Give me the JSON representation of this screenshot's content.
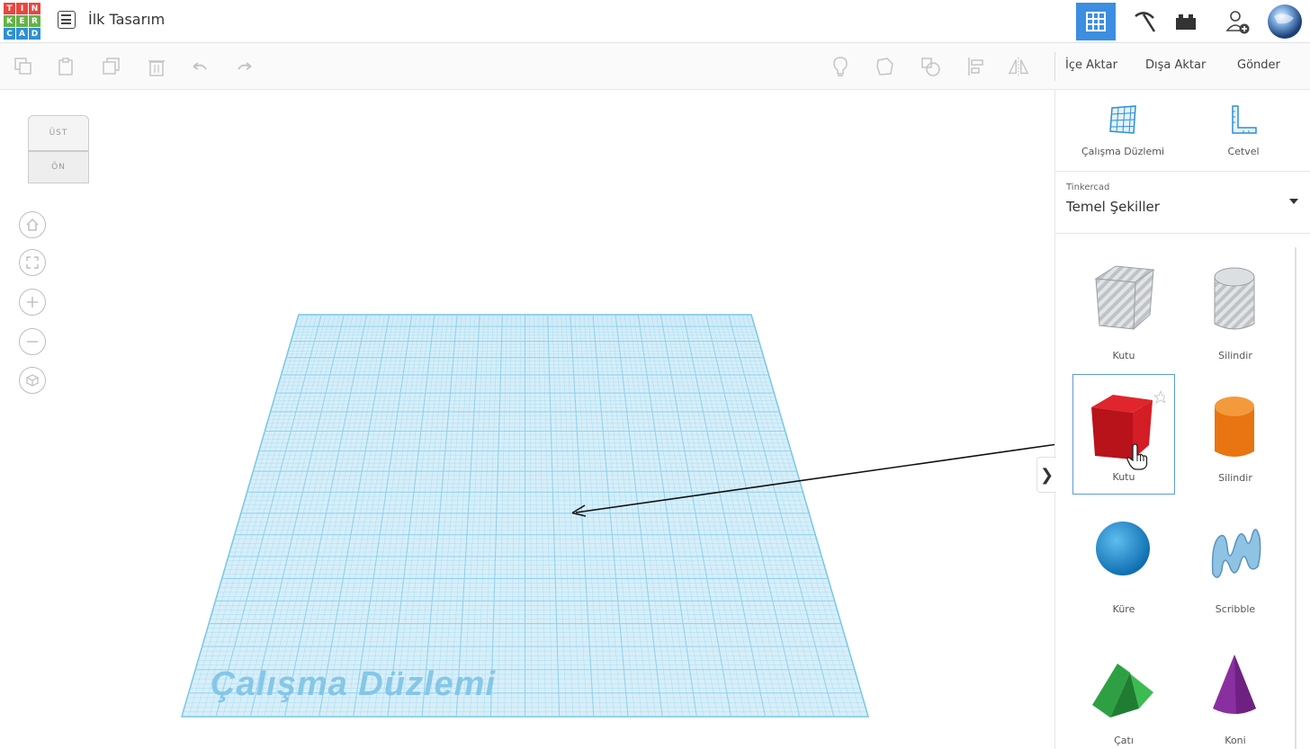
{
  "header": {
    "logo_letters": [
      "T",
      "I",
      "N",
      "K",
      "E",
      "R",
      "C",
      "A",
      "D"
    ],
    "design_title": "İlk Tasarım",
    "accent_color": "#3c8ee0"
  },
  "toolbar": {
    "import_label": "İçe Aktar",
    "export_label": "Dışa Aktar",
    "send_label": "Gönder"
  },
  "viewcube": {
    "top_label": "ÜST",
    "front_label": "ÖN"
  },
  "workplane": {
    "label": "Çalışma Düzlemi",
    "grid_color": "#8fd0ee"
  },
  "panel": {
    "workplane_tool_label": "Çalışma Düzlemi",
    "ruler_tool_label": "Cetvel",
    "library_source": "Tinkercad",
    "library_name": "Temel Şekiller",
    "shapes": [
      {
        "label": "Kutu",
        "kind": "box-hole"
      },
      {
        "label": "Silindir",
        "kind": "cylinder-hole"
      },
      {
        "label": "Kutu",
        "kind": "box",
        "color": "#c8141b"
      },
      {
        "label": "Silindir",
        "kind": "cylinder",
        "color": "#e87511"
      },
      {
        "label": "Küre",
        "kind": "sphere",
        "color": "#1b8fd2"
      },
      {
        "label": "Scribble",
        "kind": "scribble",
        "color": "#7fb2d6"
      },
      {
        "label": "Çatı",
        "kind": "roof",
        "color": "#2ea043"
      },
      {
        "label": "Koni",
        "kind": "cone",
        "color": "#8a2fa0"
      }
    ],
    "collapse_glyph": "❯"
  }
}
